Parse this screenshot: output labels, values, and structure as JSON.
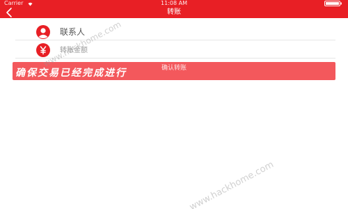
{
  "status_bar": {
    "carrier": "Carrier",
    "time": "11:08 AM"
  },
  "nav": {
    "title": "转账",
    "back_icon": "chevron-left-icon"
  },
  "form": {
    "contact_label": "联系人",
    "contact_icon": "person-avatar-icon",
    "amount_label": "转账金额",
    "amount_icon": "yuan-coin-icon"
  },
  "confirm": {
    "label": "确认转账"
  },
  "overlay_caption": "确保交易已经完成进行",
  "watermarks": {
    "top": "www.hackhome.com",
    "bottom": "www.hackhome.com"
  },
  "colors": {
    "brand_red": "#e81f25",
    "button_red": "#f3585c",
    "text_gray": "#555555"
  }
}
